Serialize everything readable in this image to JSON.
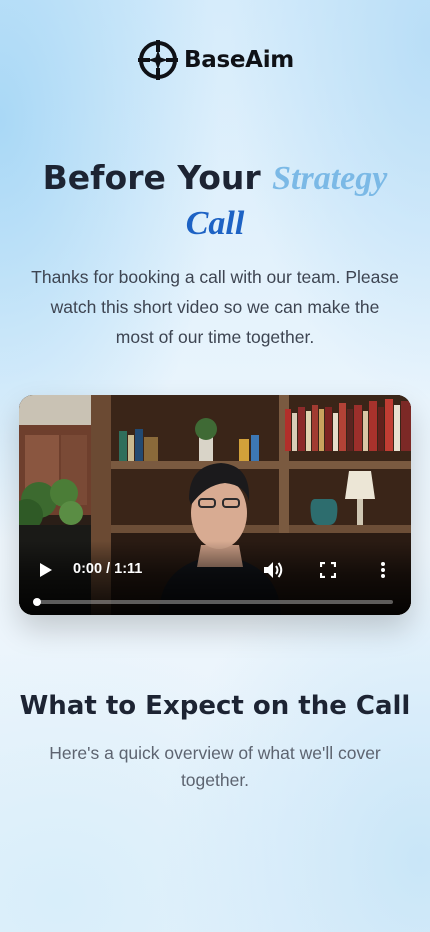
{
  "brand": {
    "name": "BaseAim",
    "icon": "crosshair-logo-icon"
  },
  "hero": {
    "title_plain": "Before Your",
    "title_accent_1": "Strategy",
    "title_accent_2": "Call",
    "subtitle": "Thanks for booking a call with our team. Please watch this short video so we can make the most of our time together.",
    "accent_colors": [
      "#7bb9e6",
      "#1d62c4"
    ]
  },
  "video": {
    "current_time": "0:00",
    "separator": "/",
    "duration": "1:11",
    "progress_fraction": 0,
    "controls": {
      "play": "play-icon",
      "volume": "volume-icon",
      "fullscreen": "fullscreen-icon",
      "more": "more-vertical-icon"
    }
  },
  "expect": {
    "title": "What to Expect on the Call",
    "subtitle": "Here's a quick overview of what we'll cover together."
  }
}
